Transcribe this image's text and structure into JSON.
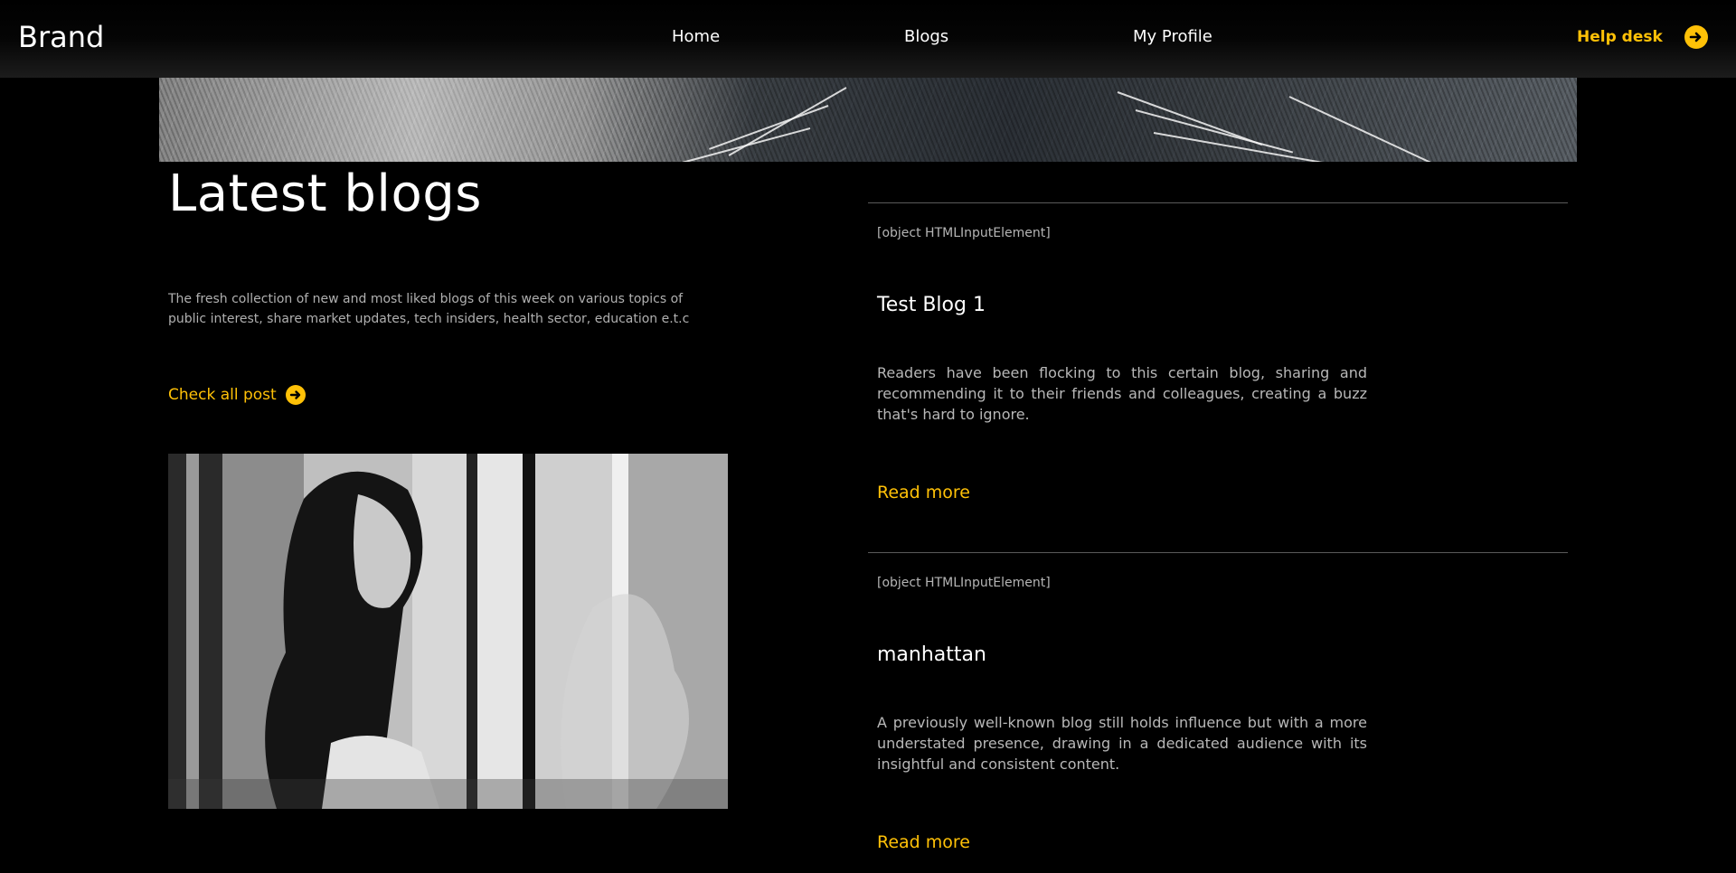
{
  "header": {
    "brand": "Brand",
    "nav": [
      "Home",
      "Blogs",
      "My Profile"
    ],
    "help_label": "Help desk",
    "accent_color": "#ffc107"
  },
  "hero": {
    "title": "Latest blogs",
    "description": "The fresh collection of new and most liked blogs of this week on various topics of public interest, share market updates, tech insiders, health sector, education e.t.c",
    "check_all_label": "Check all post"
  },
  "posts": [
    {
      "meta": "[object HTMLInputElement]",
      "title": "Test Blog 1",
      "excerpt": "Readers have been flocking to this certain blog, sharing and recommending it to their friends and colleagues, creating a buzz that's hard to ignore.",
      "read_more": "Read more"
    },
    {
      "meta": "[object HTMLInputElement]",
      "title": "manhattan",
      "excerpt": "A previously well-known blog still holds influence but with a more understated presence, drawing in a dedicated audience with its insightful and consistent content.",
      "read_more": "Read more"
    }
  ]
}
